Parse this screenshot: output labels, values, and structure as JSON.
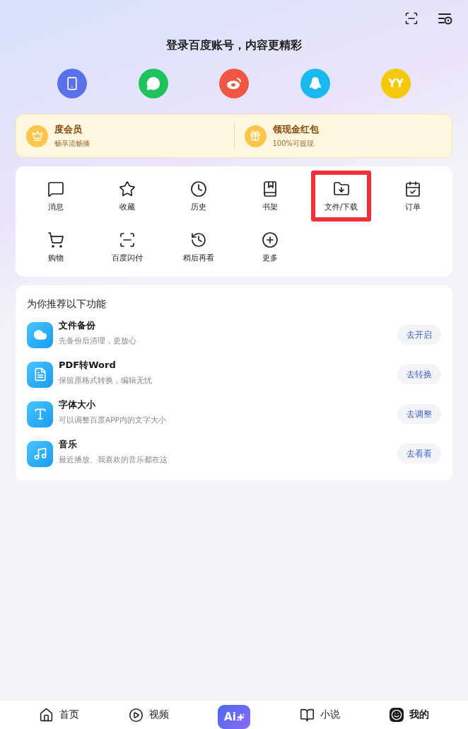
{
  "login": {
    "title": "登录百度账号，内容更精彩",
    "options": [
      {
        "kind": "phone",
        "color": "#5a72e8"
      },
      {
        "kind": "wechat",
        "color": "#1fc35b"
      },
      {
        "kind": "weibo",
        "color": "#ef5643"
      },
      {
        "kind": "qq",
        "color": "#19b8f0"
      },
      {
        "kind": "yy",
        "color": "#f5c90a",
        "text": "YY"
      }
    ]
  },
  "perks": [
    {
      "kind": "vip",
      "title": "度会员",
      "subtitle": "畅享流畅播"
    },
    {
      "kind": "redpacket",
      "title": "领现金红包",
      "subtitle": "100%可提现"
    }
  ],
  "shortcuts": [
    {
      "kind": "message",
      "label": "消息",
      "highlighted": false
    },
    {
      "kind": "star",
      "label": "收藏",
      "highlighted": false
    },
    {
      "kind": "clock",
      "label": "历史",
      "highlighted": false
    },
    {
      "kind": "bookmark",
      "label": "书架",
      "highlighted": false
    },
    {
      "kind": "download",
      "label": "文件/下载",
      "highlighted": true
    },
    {
      "kind": "calendar",
      "label": "订单",
      "highlighted": false
    },
    {
      "kind": "cart",
      "label": "购物",
      "highlighted": false
    },
    {
      "kind": "scan",
      "label": "百度闪付",
      "highlighted": false
    },
    {
      "kind": "later",
      "label": "稍后再看",
      "highlighted": false
    },
    {
      "kind": "plus",
      "label": "更多",
      "highlighted": false
    }
  ],
  "recommend": {
    "title": "为你推荐以下功能",
    "items": [
      {
        "kind": "cloud",
        "title": "文件备份",
        "description": "先备份后清理，更放心",
        "action": "去开启"
      },
      {
        "kind": "pdf",
        "title": "PDF转Word",
        "description": "保留原格式转换，编辑无忧",
        "action": "去转换"
      },
      {
        "kind": "font",
        "title": "字体大小",
        "description": "可以调整百度APP内的文字大小",
        "action": "去调整"
      },
      {
        "kind": "music",
        "title": "音乐",
        "description": "最近播放、我喜欢的音乐都在这",
        "action": "去看看"
      }
    ]
  },
  "tab_bar": [
    {
      "kind": "home",
      "label": "首页",
      "selected": false
    },
    {
      "kind": "video",
      "label": "视频",
      "selected": false
    },
    {
      "kind": "ai",
      "label": "Ai",
      "selected": false
    },
    {
      "kind": "novel",
      "label": "小说",
      "selected": false
    },
    {
      "kind": "me",
      "label": "我的",
      "selected": true
    }
  ]
}
